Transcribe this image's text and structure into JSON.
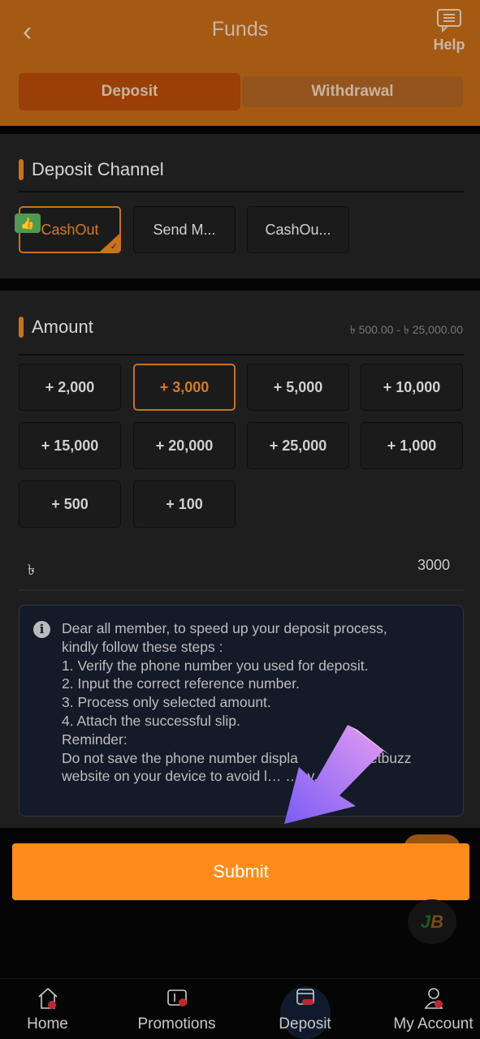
{
  "header": {
    "title": "Funds",
    "help_label": "Help",
    "back_icon": "chevron-left-icon",
    "help_icon": "chat-icon"
  },
  "tabs": [
    {
      "label": "Deposit",
      "active": true
    },
    {
      "label": "Withdrawal",
      "active": false
    }
  ],
  "deposit_channel": {
    "title": "Deposit Channel",
    "channels": [
      {
        "label": "CashOut",
        "selected": true,
        "badge_icon": "thumbs-up-icon"
      },
      {
        "label": "Send M..."
      },
      {
        "label": "CashOu..."
      }
    ]
  },
  "amount": {
    "title": "Amount",
    "range": "৳ 500.00 - ৳ 25,000.00",
    "options": [
      "+ 2,000",
      "+ 3,000",
      "+ 5,000",
      "+ 10,000",
      "+ 15,000",
      "+ 20,000",
      "+ 25,000",
      "+ 1,000",
      "+ 500",
      "+ 100"
    ],
    "selected": "+ 3,000",
    "currency": "৳",
    "value": "3000"
  },
  "notice": {
    "lines": [
      "Dear all member, to speed up your deposit process,",
      "kindly follow these steps :",
      "1. Verify the phone number you used for deposit.",
      "2. Input the correct reference number.",
      "3. Process only selected amount.",
      "4. Attach the successful slip.",
      "Reminder:"
    ],
    "last_line_a": "Do not save the phone number displa",
    "last_line_b": "etbuzz",
    "last_line_c": "website on your device to avoid l… …ey."
  },
  "submit_label": "Submit",
  "bottom_nav": [
    {
      "label": "Home",
      "icon": "home-icon"
    },
    {
      "label": "Promotions",
      "icon": "ticket-icon"
    },
    {
      "label": "Deposit",
      "icon": "wallet-icon",
      "active": true
    },
    {
      "label": "My Account",
      "icon": "user-icon"
    }
  ],
  "colors": {
    "accent": "#ff8c1a",
    "header": "#a55a14",
    "selected": "#c9721d"
  }
}
